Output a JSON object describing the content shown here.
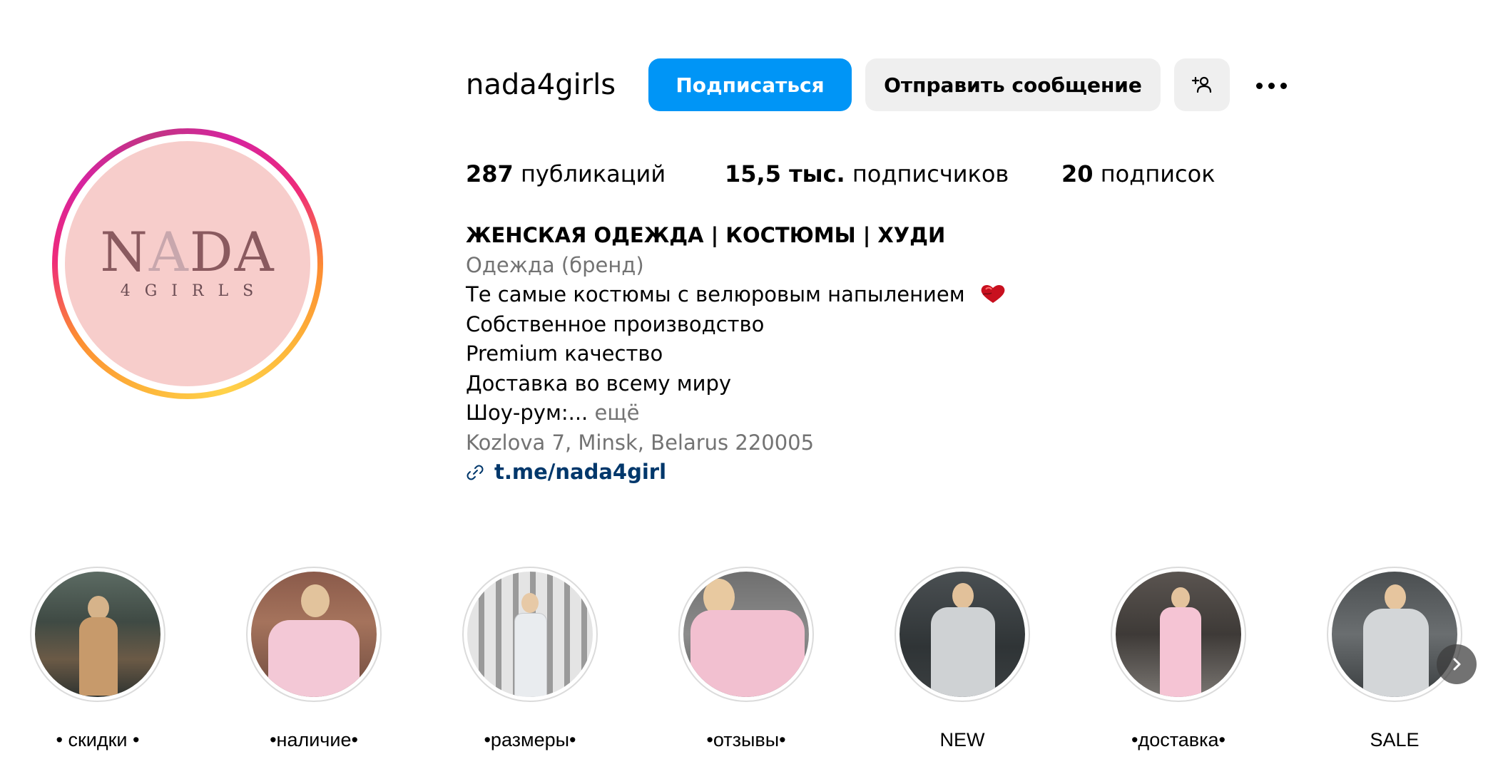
{
  "profile": {
    "username": "nada4girls",
    "avatar_logo_main": "NADA",
    "avatar_logo_sub": "4GIRLS"
  },
  "actions": {
    "follow_label": "Подписаться",
    "message_label": "Отправить сообщение",
    "suggest_icon": "add-person-icon",
    "more_icon": "more-horizontal-icon"
  },
  "stats": {
    "posts_count": "287",
    "posts_label": "публикаций",
    "followers_count": "15,5 тыс.",
    "followers_label": "подписчиков",
    "following_count": "20",
    "following_label": "подписок"
  },
  "bio": {
    "name": "ЖЕНСКАЯ ОДЕЖДА | КОСТЮМЫ | ХУДИ",
    "category": "Одежда (бренд)",
    "line1": "Те самые костюмы с велюровым напылением",
    "line1_emoji": "heart-emoji",
    "line2": "Собственное производство",
    "line3": "Premium качество",
    "line4": "Доставка во всему миру",
    "line5": "Шоу-рум:...",
    "more_label": "ещё",
    "address": "Kozlova 7, Minsk, Belarus 220005",
    "link_icon": "link-icon",
    "link": "t.me/nada4girl"
  },
  "highlights": [
    {
      "label": "• скидки •"
    },
    {
      "label": "•наличие•"
    },
    {
      "label": "•размеры•"
    },
    {
      "label": "•отзывы•"
    },
    {
      "label": "NEW"
    },
    {
      "label": "•доставка•"
    },
    {
      "label": "SALE"
    }
  ],
  "colors": {
    "primary_button": "#0095f6",
    "secondary_button": "#efefef",
    "muted_text": "#737373",
    "link_text": "#00376b",
    "avatar_bg": "#f7cdcb"
  },
  "navigation": {
    "next_icon": "chevron-right-icon"
  }
}
